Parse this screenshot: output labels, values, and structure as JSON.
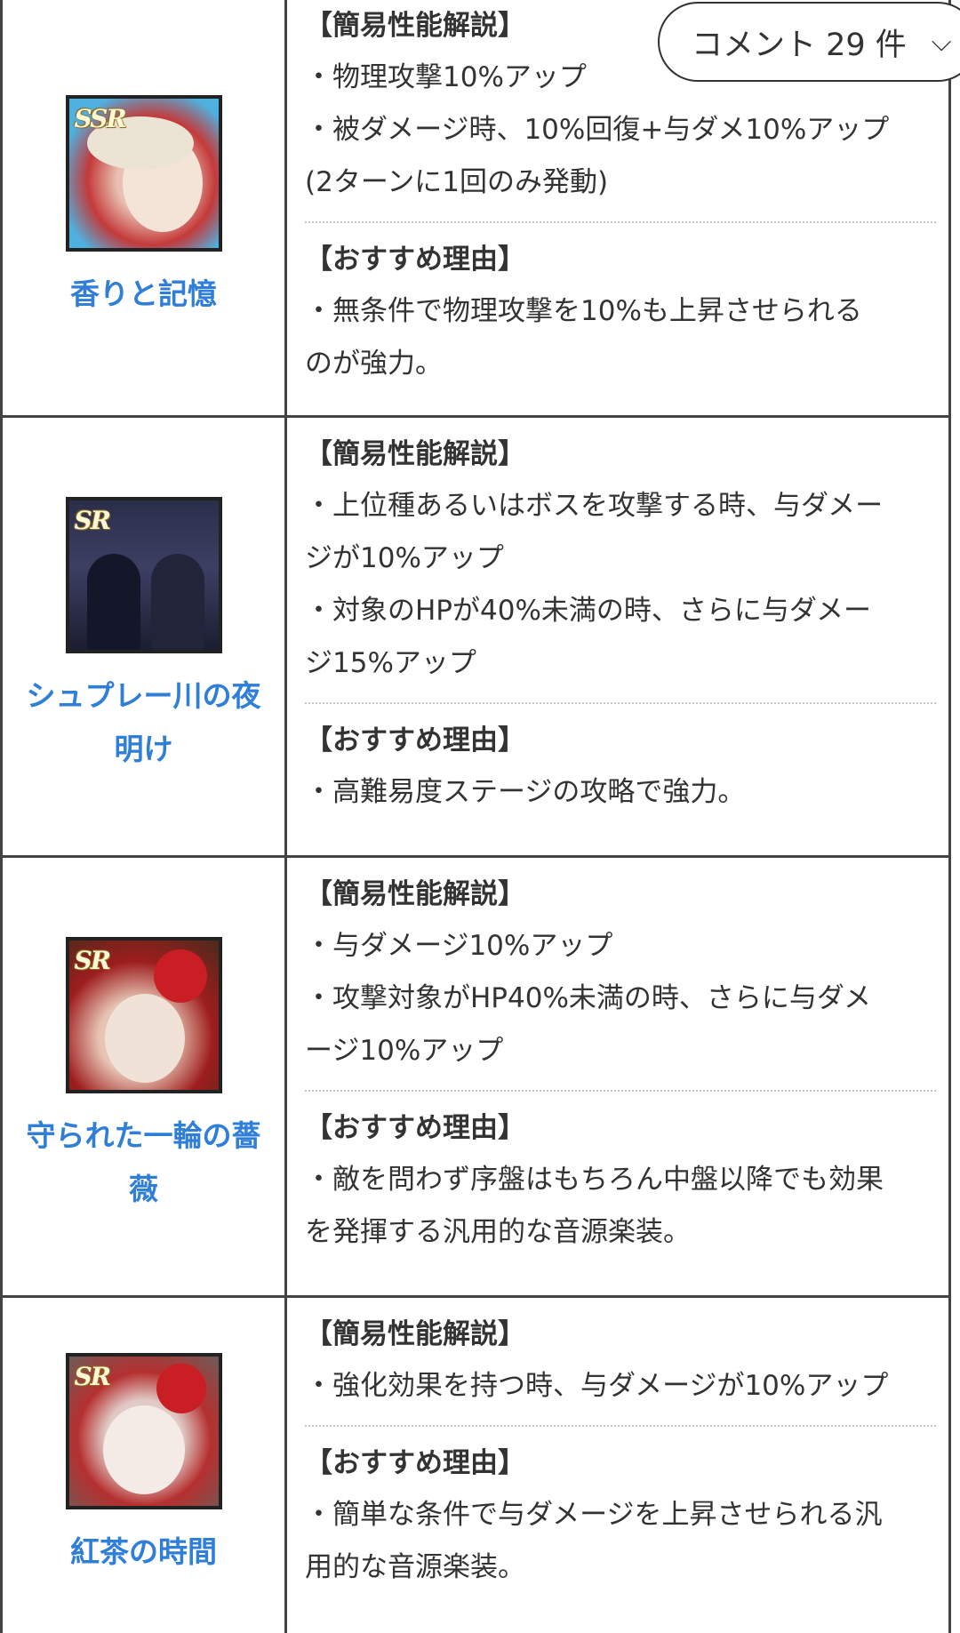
{
  "comment_button": {
    "label": "コメント 29 件",
    "chevron": "⌵"
  },
  "rows": [
    {
      "rarity": "SSR",
      "name_lines": [
        "香りと記憶"
      ],
      "sections": [
        {
          "heading": "【簡易性能解説】",
          "lines": [
            "・物理攻撃10%アップ",
            "・被ダメージ時、10%回復+与ダメ10%アップ",
            "(2ターンに1回のみ発動)"
          ]
        },
        {
          "heading": "【おすすめ理由】",
          "lines": [
            "・無条件で物理攻撃を10%も上昇させられる",
            "のが強力。"
          ]
        }
      ]
    },
    {
      "rarity": "SR",
      "name_lines": [
        "シュプレー川の夜",
        "明け"
      ],
      "sections": [
        {
          "heading": "【簡易性能解説】",
          "lines": [
            "・上位種あるいはボスを攻撃する時、与ダメー",
            "ジが10%アップ",
            "・対象のHPが40%未満の時、さらに与ダメー",
            "ジ15%アップ"
          ]
        },
        {
          "heading": "【おすすめ理由】",
          "lines": [
            "・高難易度ステージの攻略で強力。"
          ]
        }
      ]
    },
    {
      "rarity": "SR",
      "name_lines": [
        "守られた一輪の薔",
        "薇"
      ],
      "sections": [
        {
          "heading": "【簡易性能解説】",
          "lines": [
            "・与ダメージ10%アップ",
            "・攻撃対象がHP40%未満の時、さらに与ダメ",
            "ージ10%アップ"
          ]
        },
        {
          "heading": "【おすすめ理由】",
          "lines": [
            "・敵を問わず序盤はもちろん中盤以降でも効果",
            "を発揮する汎用的な音源楽装。"
          ]
        }
      ]
    },
    {
      "rarity": "SR",
      "name_lines": [
        "紅茶の時間"
      ],
      "sections": [
        {
          "heading": "【簡易性能解説】",
          "lines": [
            "・強化効果を持つ時、与ダメージが10%アップ"
          ]
        },
        {
          "heading": "【おすすめ理由】",
          "lines": [
            "・簡単な条件で与ダメージを上昇させられる汎",
            "用的な音源楽装。"
          ]
        }
      ]
    }
  ]
}
